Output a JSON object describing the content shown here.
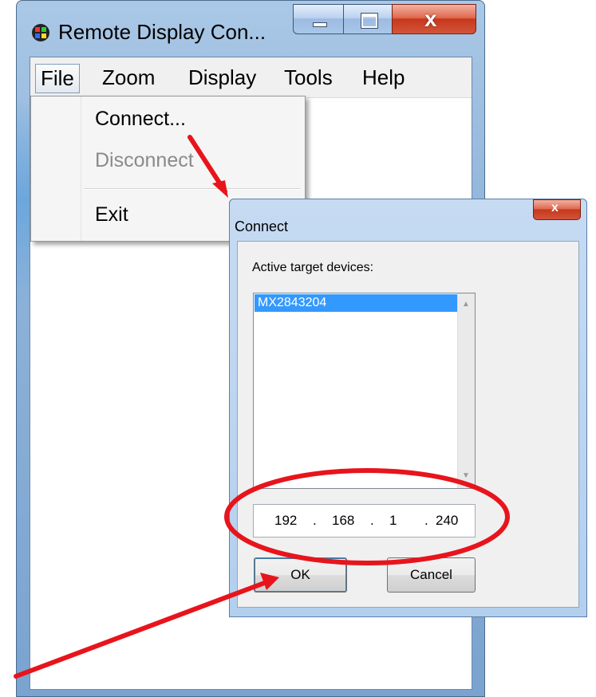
{
  "window": {
    "title": "Remote Display Con...",
    "minimize_icon": "minimize-icon",
    "maximize_icon": "maximize-icon",
    "close_glyph": "x"
  },
  "menubar": {
    "items": [
      "File",
      "Zoom",
      "Display",
      "Tools",
      "Help"
    ]
  },
  "file_menu": {
    "items": [
      {
        "label": "Connect...",
        "enabled": true
      },
      {
        "label": "Disconnect",
        "enabled": false
      },
      {
        "label": "Exit",
        "enabled": true
      }
    ]
  },
  "connect_dialog": {
    "title": "Connect",
    "close_glyph": "x",
    "list_label": "Active target devices:",
    "devices": [
      "MX2843204"
    ],
    "selected_device": "MX2843204",
    "ip_octets": [
      "192",
      "168",
      "1",
      "240"
    ],
    "ok_label": "OK",
    "cancel_label": "Cancel"
  },
  "annotations": {
    "color": "#e8141c"
  },
  "colors": {
    "titlebar": "#8fb3da",
    "selection": "#3399ff",
    "close_button": "#c7381d"
  }
}
